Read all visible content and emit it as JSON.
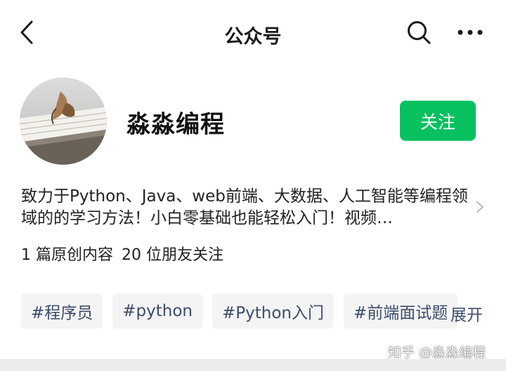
{
  "header": {
    "title": "公众号",
    "back_icon": "chevron-left-icon",
    "search_icon": "search-icon",
    "more_icon": "more-horizontal-icon"
  },
  "account": {
    "name": "淼淼编程",
    "avatar_icon": "account-avatar",
    "follow_label": "关注",
    "follow_color": "#07c160",
    "description": "致力于Python、Java、web前端、大数据、人工智能等编程领域的的学习方法！小白零基础也能轻松入门！视频…",
    "stats": {
      "original": "1 篇原创内容",
      "followers": "20 位朋友关注"
    }
  },
  "tags": [
    "#程序员",
    "#python",
    "#Python入门",
    "#前端面试题"
  ],
  "expand_label": "展开",
  "watermark": "知乎 @淼淼编程"
}
